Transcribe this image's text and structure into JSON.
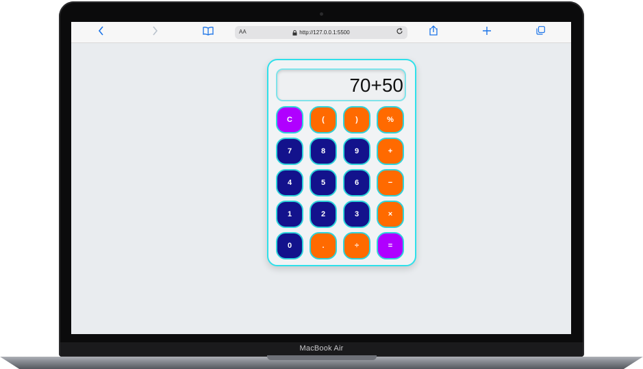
{
  "device": {
    "brand_label": "MacBook Air"
  },
  "browser": {
    "aa_label": "AA",
    "url": "http://127.0.0.1:5500",
    "icons": {
      "back": "chevron-left-icon",
      "forward": "chevron-right-icon",
      "bookmarks": "book-icon",
      "lock": "lock-icon",
      "reload": "reload-icon",
      "share": "share-icon",
      "new_tab": "plus-icon",
      "tabs": "tabs-icon"
    }
  },
  "calculator": {
    "display_value": "70+50",
    "colors": {
      "number": "#13128c",
      "operator": "#ff6a00",
      "special": "#b000ff",
      "border": "#2ed3da"
    },
    "keys": [
      {
        "label": "C",
        "type": "special"
      },
      {
        "label": "(",
        "type": "operator"
      },
      {
        "label": ")",
        "type": "operator"
      },
      {
        "label": "%",
        "type": "operator"
      },
      {
        "label": "7",
        "type": "number"
      },
      {
        "label": "8",
        "type": "number"
      },
      {
        "label": "9",
        "type": "number"
      },
      {
        "label": "+",
        "type": "operator"
      },
      {
        "label": "4",
        "type": "number"
      },
      {
        "label": "5",
        "type": "number"
      },
      {
        "label": "6",
        "type": "number"
      },
      {
        "label": "−",
        "type": "operator"
      },
      {
        "label": "1",
        "type": "number"
      },
      {
        "label": "2",
        "type": "number"
      },
      {
        "label": "3",
        "type": "number"
      },
      {
        "label": "×",
        "type": "operator"
      },
      {
        "label": "0",
        "type": "number"
      },
      {
        "label": ".",
        "type": "operator"
      },
      {
        "label": "÷",
        "type": "operator"
      },
      {
        "label": "=",
        "type": "special"
      }
    ]
  }
}
